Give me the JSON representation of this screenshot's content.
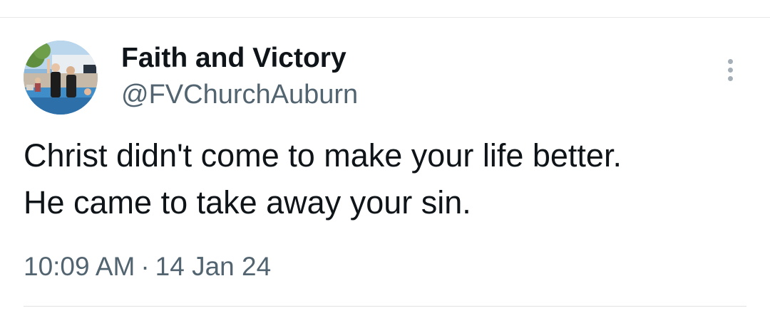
{
  "tweet": {
    "author": {
      "display_name": "Faith and Victory",
      "handle": "@FVChurchAuburn",
      "avatar_icon": "profile-photo-avatar"
    },
    "text_lines": [
      "Christ didn't come to make your life better.",
      "He came to take away your sin."
    ],
    "time": "10:09 AM",
    "separator": "·",
    "date": "14 Jan 24",
    "more_icon": "more-options-icon"
  },
  "colors": {
    "primary_text": "#0f1419",
    "secondary_text": "#536471",
    "divider": "#e8e8e8",
    "background": "#ffffff"
  }
}
